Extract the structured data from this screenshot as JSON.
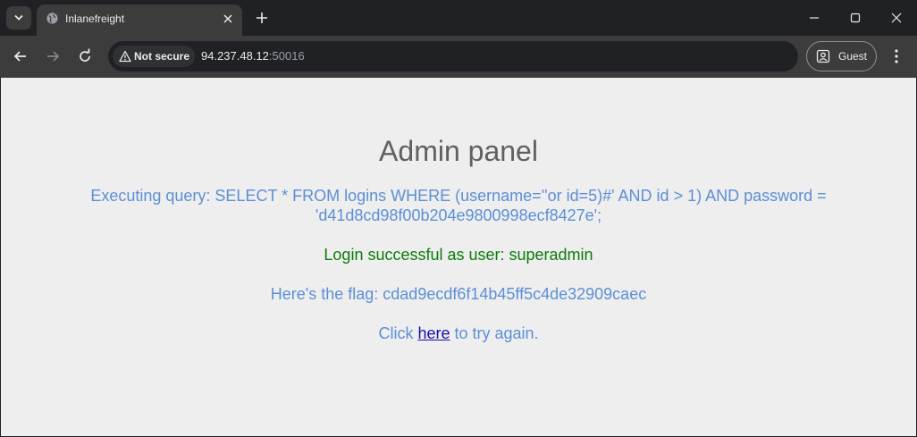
{
  "browser": {
    "tab": {
      "title": "Inlanefreight"
    },
    "toolbar": {
      "security_label": "Not secure",
      "url_host": "94.237.48.12",
      "url_port": ":50016",
      "profile_label": "Guest"
    },
    "icons": {
      "tab_search": "chevron-down-icon",
      "favicon": "globe-icon",
      "tab_close": "close-icon",
      "new_tab": "plus-icon",
      "minimize": "minimize-icon",
      "maximize": "maximize-icon",
      "close_window": "close-icon",
      "back": "arrow-left-icon",
      "forward": "arrow-right-icon",
      "reload": "reload-icon",
      "warning": "warning-icon",
      "profile": "person-icon",
      "menu": "kebab-menu-icon"
    }
  },
  "page": {
    "title": "Admin panel",
    "query_text": "Executing query: SELECT * FROM logins WHERE (username=''or id=5)#' AND id > 1) AND password = 'd41d8cd98f00b204e9800998ecf8427e';",
    "success_text": "Login successful as user: superadmin",
    "flag_text": "Here's the flag: cdad9ecdf6f14b45ff5c4de32909caec",
    "again_prefix": "Click ",
    "again_link": "here",
    "again_suffix": " to try again."
  },
  "colors": {
    "page_background": "#eeeeee",
    "title": "#606060",
    "info_text": "#5c8fd6",
    "success_text": "#0c7a0c",
    "link": "#1a0dab"
  }
}
